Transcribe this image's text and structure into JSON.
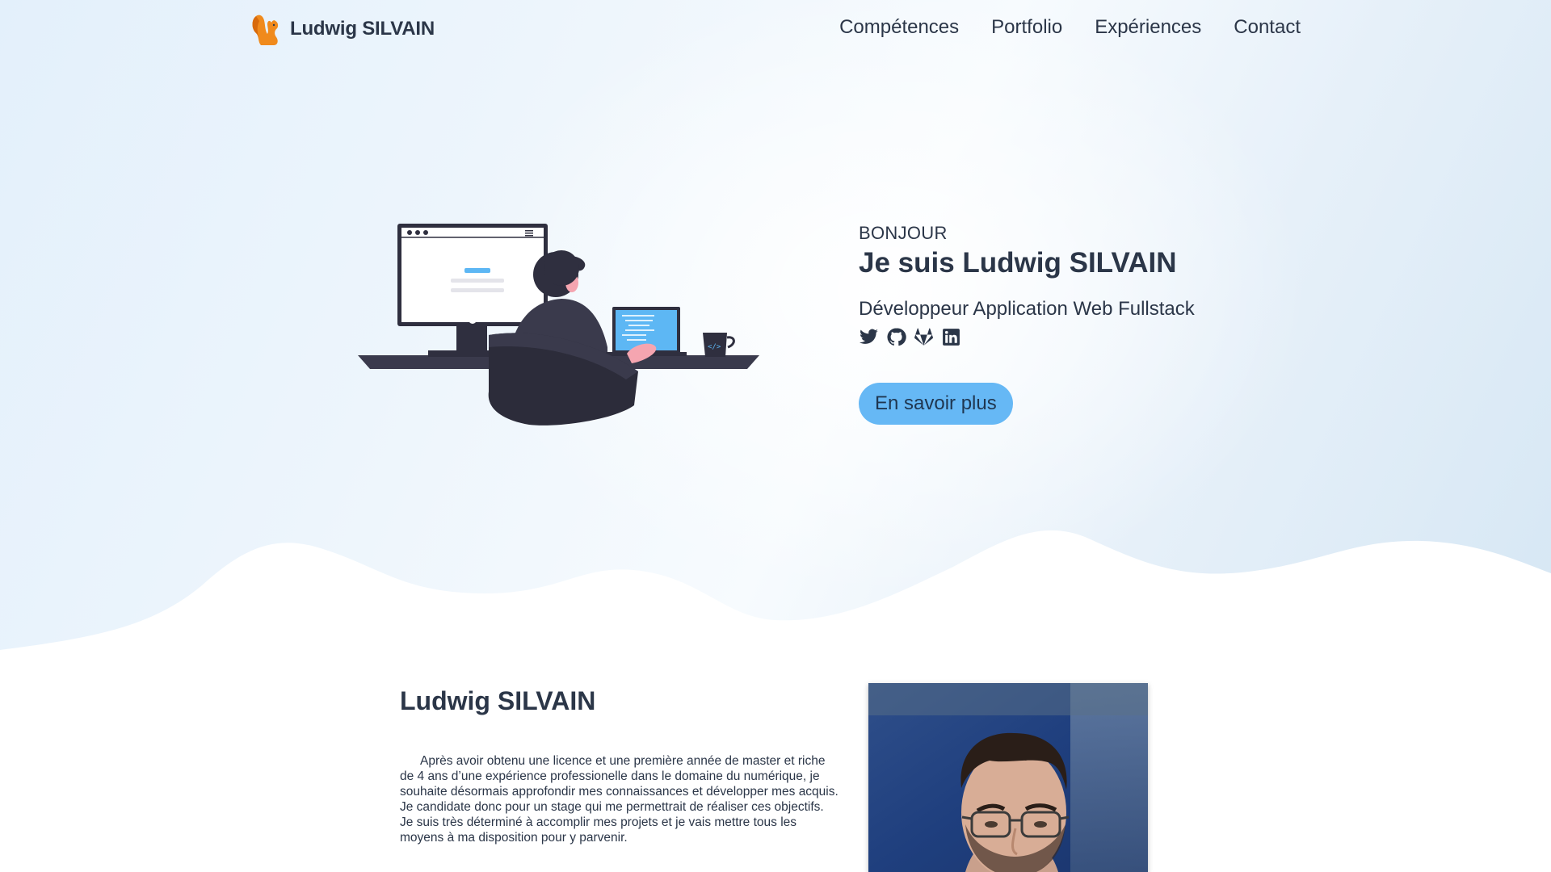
{
  "nav": {
    "brand_name": "Ludwig SILVAIN",
    "items": [
      {
        "label": "Compétences"
      },
      {
        "label": "Portfolio"
      },
      {
        "label": "Expériences"
      },
      {
        "label": "Contact"
      }
    ]
  },
  "hero": {
    "greeting": "BONJOUR",
    "headline": "Je suis Ludwig SILVAIN",
    "subtitle": "Développeur Application Web Fullstack",
    "socials": [
      "twitter-icon",
      "github-icon",
      "gitlab-icon",
      "linkedin-icon"
    ],
    "cta_label": "En savoir plus"
  },
  "about": {
    "title": "Ludwig SILVAIN",
    "text": "Après avoir obtenu une licence et une première année de master et riche de 4 ans d’une expérience professionelle dans le domaine du numérique, je souhaite désormais approfondir mes connaissances et développer mes acquis. Je candidate donc pour un stage qui me permettrait de réaliser ces objectifs. Je suis très déterminé à accomplir mes projets et je vais mettre tous les moyens à ma disposition pour y parvenir."
  },
  "colors": {
    "accent": "#66b8f5",
    "text": "#2b3648",
    "logo": "#f08a1c"
  }
}
